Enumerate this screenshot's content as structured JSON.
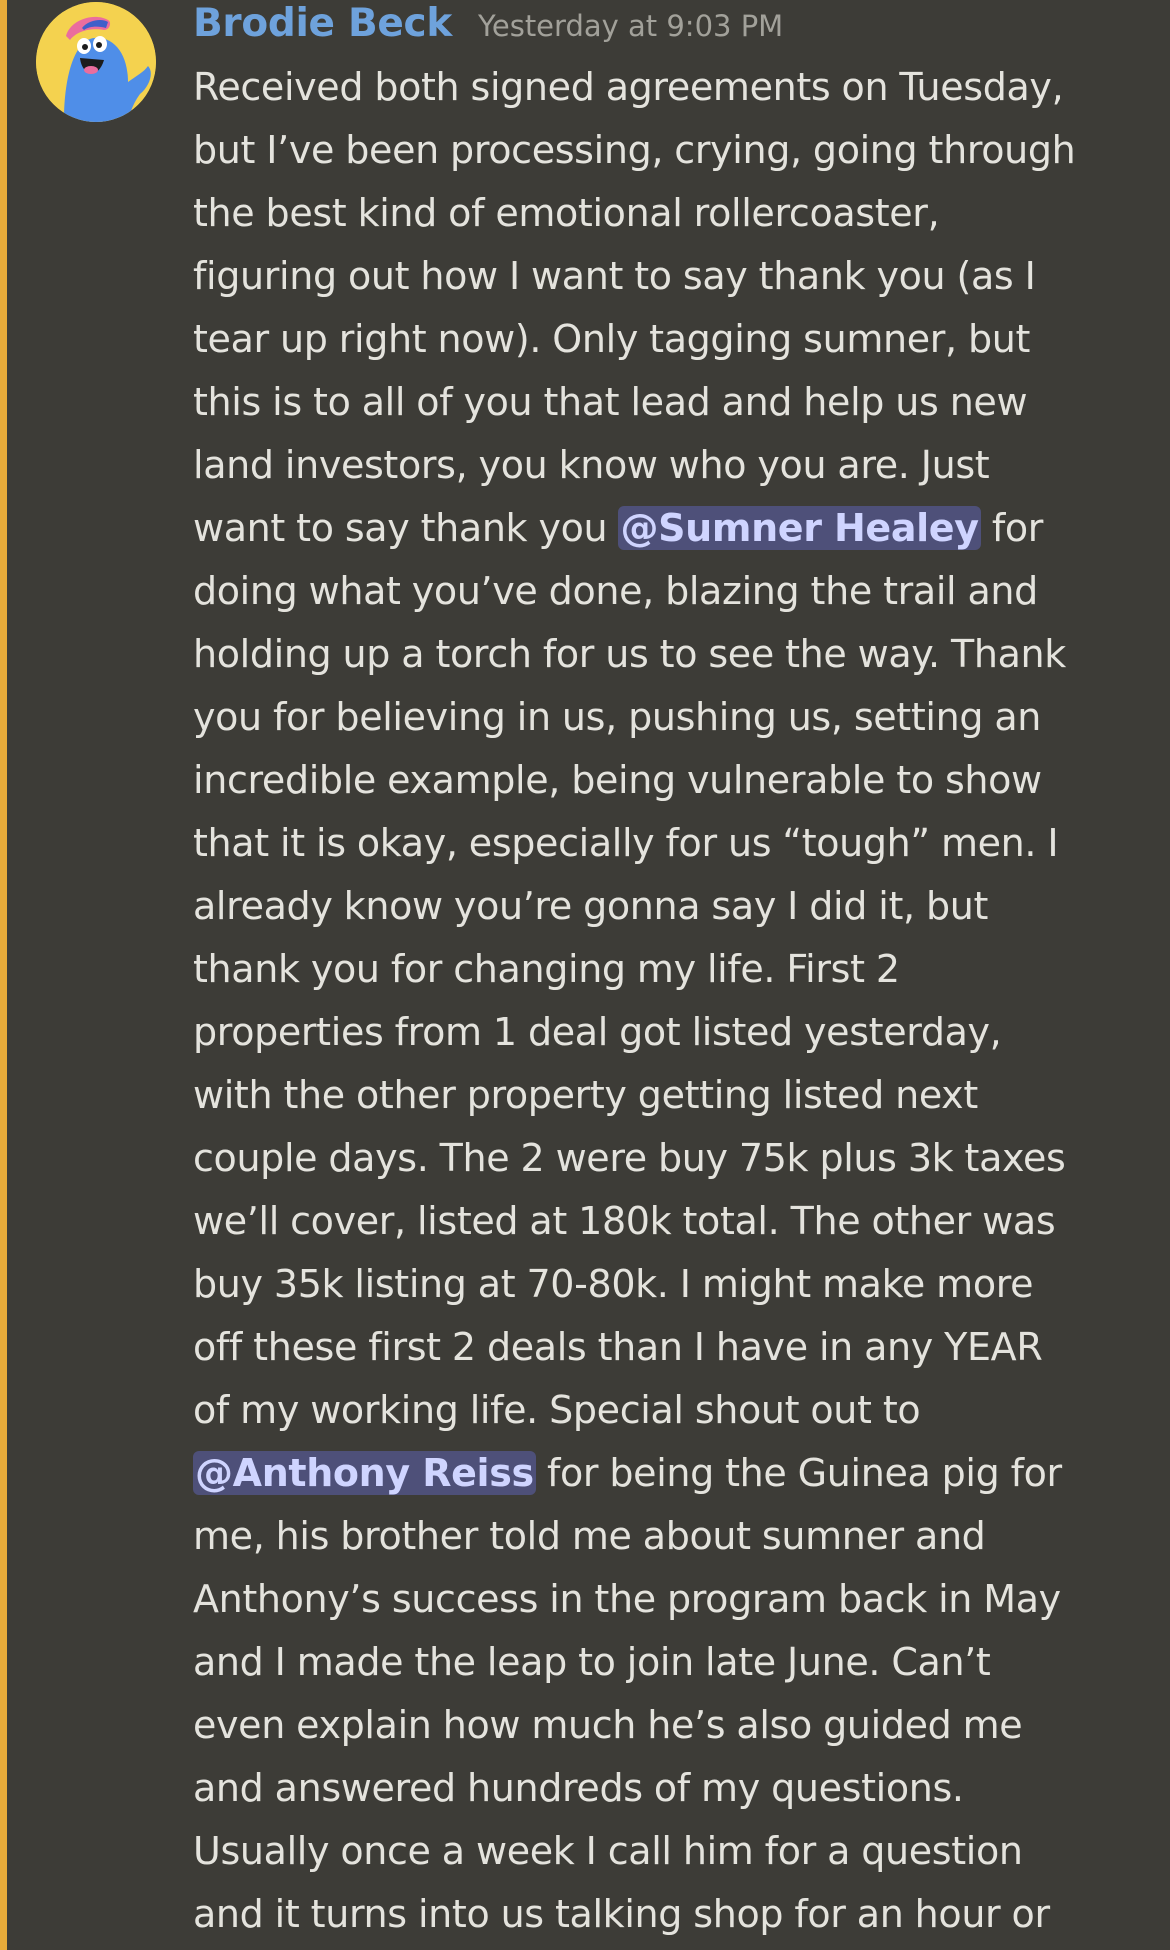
{
  "message": {
    "username": "Brodie Beck",
    "timestamp": "Yesterday at 9:03 PM",
    "highlight_color": "#e8ab3a",
    "username_color": "#6ea2dc",
    "mention_bg": "#4e5079",
    "lines": [
      [
        "Received both signed agreements on Tuesday,"
      ],
      [
        "but I’ve been processing, crying, going through"
      ],
      [
        "the best kind of emotional rollercoaster,"
      ],
      [
        "figuring out how I want to say thank you (as I"
      ],
      [
        "tear up right now). Only tagging sumner, but"
      ],
      [
        "this is to all of you that lead and help us new"
      ],
      [
        "land investors, you know who you are. Just"
      ],
      [
        "want to say thank you ",
        "@Sumner Healey",
        " for"
      ],
      [
        "doing what you’ve done, blazing the trail and"
      ],
      [
        "holding up a torch for us to see the way. Thank"
      ],
      [
        "you for believing in us, pushing us, setting an"
      ],
      [
        "incredible example, being vulnerable to show"
      ],
      [
        "that it is okay, especially for us “tough” men. I"
      ],
      [
        "already know you’re gonna say I did it, but"
      ],
      [
        "thank you for changing my life. First 2"
      ],
      [
        "properties from 1 deal got listed yesterday,"
      ],
      [
        "with the other property getting listed next"
      ],
      [
        "couple days. The 2 were buy 75k plus 3k taxes"
      ],
      [
        "we’ll cover, listed at 180k total. The other was"
      ],
      [
        "buy 35k listing at 70-80k. I might make more"
      ],
      [
        "off these first 2 deals than I have in any YEAR"
      ],
      [
        "of my working life. Special shout out to"
      ],
      [
        "",
        "@Anthony Reiss",
        " for being the Guinea pig for"
      ],
      [
        "me, his brother told me about sumner and"
      ],
      [
        "Anthony’s success in the program back in May"
      ],
      [
        "and I made the leap to join late June. Can’t"
      ],
      [
        "even explain how much he’s also guided me"
      ],
      [
        "and answered hundreds of my questions."
      ],
      [
        "Usually once a week I call him for a question"
      ],
      [
        "and it turns into us talking shop for an hour or"
      ]
    ]
  }
}
